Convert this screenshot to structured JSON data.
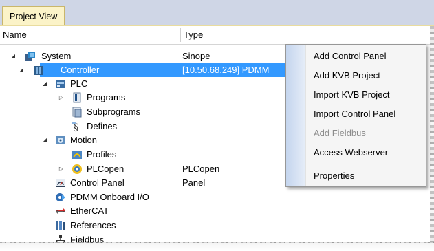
{
  "tab": {
    "label": "Project View"
  },
  "columns": {
    "name": "Name",
    "type": "Type"
  },
  "tree": {
    "system": {
      "label": "System",
      "type": "Sinope"
    },
    "controller": {
      "label": "Controller",
      "type": "[10.50.68.249] PDMM"
    },
    "plc": {
      "label": "PLC"
    },
    "programs": {
      "label": "Programs"
    },
    "subprograms": {
      "label": "Subprograms"
    },
    "defines": {
      "label": "Defines"
    },
    "motion": {
      "label": "Motion"
    },
    "profiles": {
      "label": "Profiles"
    },
    "plcopen": {
      "label": "PLCopen",
      "type": "PLCopen"
    },
    "control_panel": {
      "label": "Control Panel",
      "type": "Panel"
    },
    "onboard_io": {
      "label": "PDMM Onboard I/O"
    },
    "ethercat": {
      "label": "EtherCAT"
    },
    "references": {
      "label": "References"
    },
    "fieldbus": {
      "label": "Fieldbus"
    }
  },
  "context_menu": {
    "add_control_panel": "Add Control Panel",
    "add_kvb_project": "Add KVB Project",
    "import_kvb_project": "Import KVB Project",
    "import_control_panel": "Import Control Panel",
    "add_fieldbus": "Add Fieldbus",
    "access_webserver": "Access Webserver",
    "properties": "Properties"
  },
  "colors": {
    "selection": "#3399ff",
    "tab_bg": "#fbf3c8",
    "tabstrip_bg": "#cfd6e6"
  }
}
